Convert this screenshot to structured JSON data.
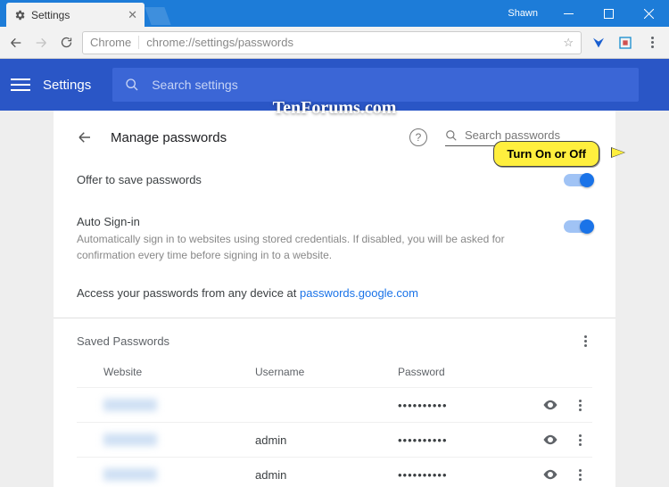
{
  "window": {
    "user": "Shawn"
  },
  "tab": {
    "title": "Settings"
  },
  "omnibox": {
    "protocol_label": "Chrome",
    "url": "chrome://settings/passwords"
  },
  "header": {
    "title": "Settings",
    "search_placeholder": "Search settings"
  },
  "page": {
    "title": "Manage passwords",
    "search_placeholder": "Search passwords",
    "offer_label": "Offer to save passwords",
    "autosignin_label": "Auto Sign-in",
    "autosignin_desc": "Automatically sign in to websites using stored credentials. If disabled, you will be asked for confirmation every time before signing in to a website.",
    "access_prefix": "Access your passwords from any device at ",
    "access_link": "passwords.google.com",
    "saved_heading": "Saved Passwords",
    "cols": {
      "website": "Website",
      "username": "Username",
      "password": "Password"
    },
    "rows": [
      {
        "website": "",
        "username": "",
        "password": "••••••••••"
      },
      {
        "website": "",
        "username": "admin",
        "password": "••••••••••"
      },
      {
        "website": "",
        "username": "admin",
        "password": "••••••••••"
      }
    ]
  },
  "callout": {
    "text": "Turn On or Off"
  },
  "watermark": "TenForums.com"
}
